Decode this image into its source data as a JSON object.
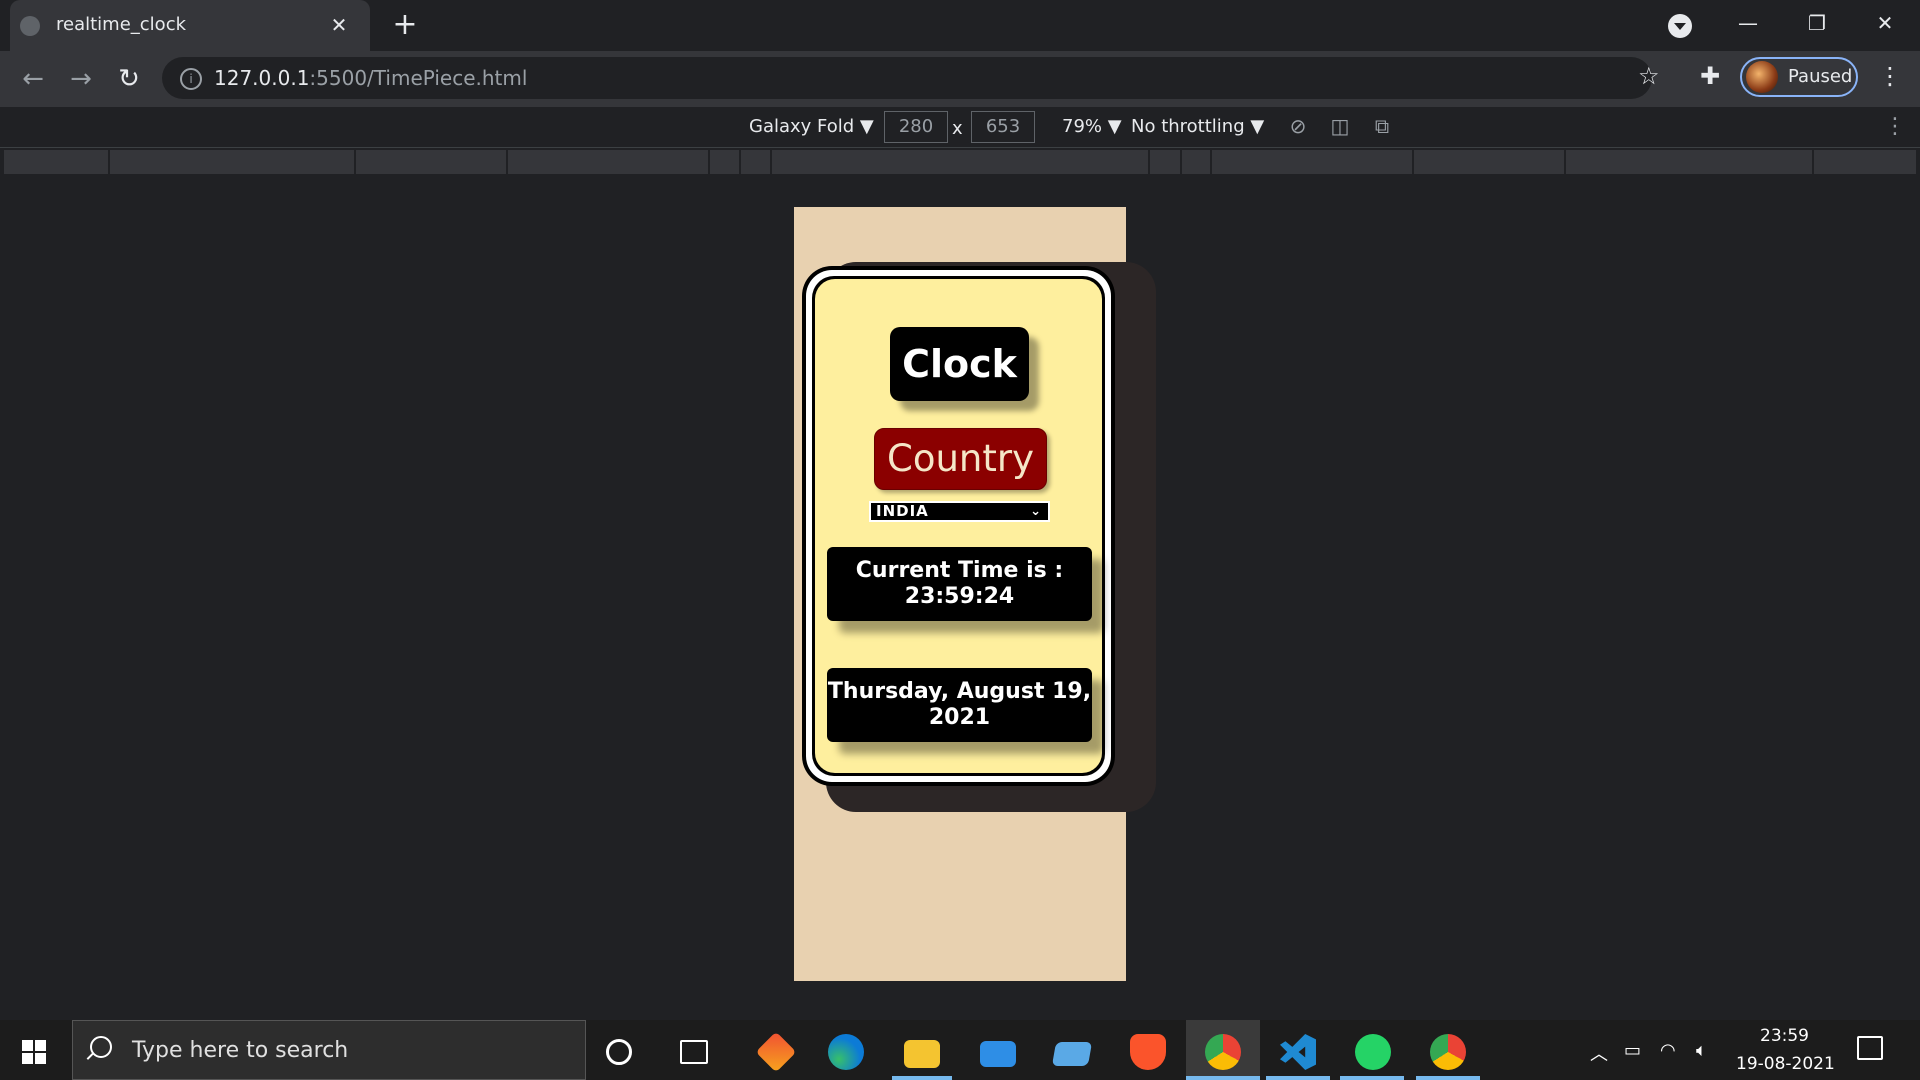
{
  "browser": {
    "tab_title": "realtime_clock",
    "tab_close": "✕",
    "new_tab": "+",
    "url_host": "127.0.0.1",
    "url_rest": ":5500/TimePiece.html",
    "profile_label": "Paused"
  },
  "devtools": {
    "device": "Galaxy Fold ▼",
    "width": "280",
    "height": "653",
    "times": "x",
    "zoom": "79% ▼",
    "throttling": "No throttling ▼"
  },
  "page": {
    "clock_title": "Clock",
    "country_label": "Country",
    "country_selected": "INDIA",
    "time_label": "Current Time is :",
    "time_value": "23:59:24",
    "date_line1": "Thursday, August 19,",
    "date_line2": "2021",
    "colors": {
      "page_bg": "#e8d1b0",
      "card_bg": "#feef9e",
      "country_button": "#8b0000",
      "box_bg": "#000000"
    }
  },
  "taskbar": {
    "search_placeholder": "Type here to search",
    "time": "23:59",
    "date": "19-08-2021",
    "icons": [
      "windows-start-icon",
      "cortana-icon",
      "task-view-icon",
      "git-icon",
      "edge-icon",
      "file-explorer-icon",
      "mail-icon",
      "laptop-icon",
      "brave-icon",
      "chrome-icon",
      "vscode-icon",
      "whatsapp-icon",
      "chrome-icon"
    ]
  }
}
